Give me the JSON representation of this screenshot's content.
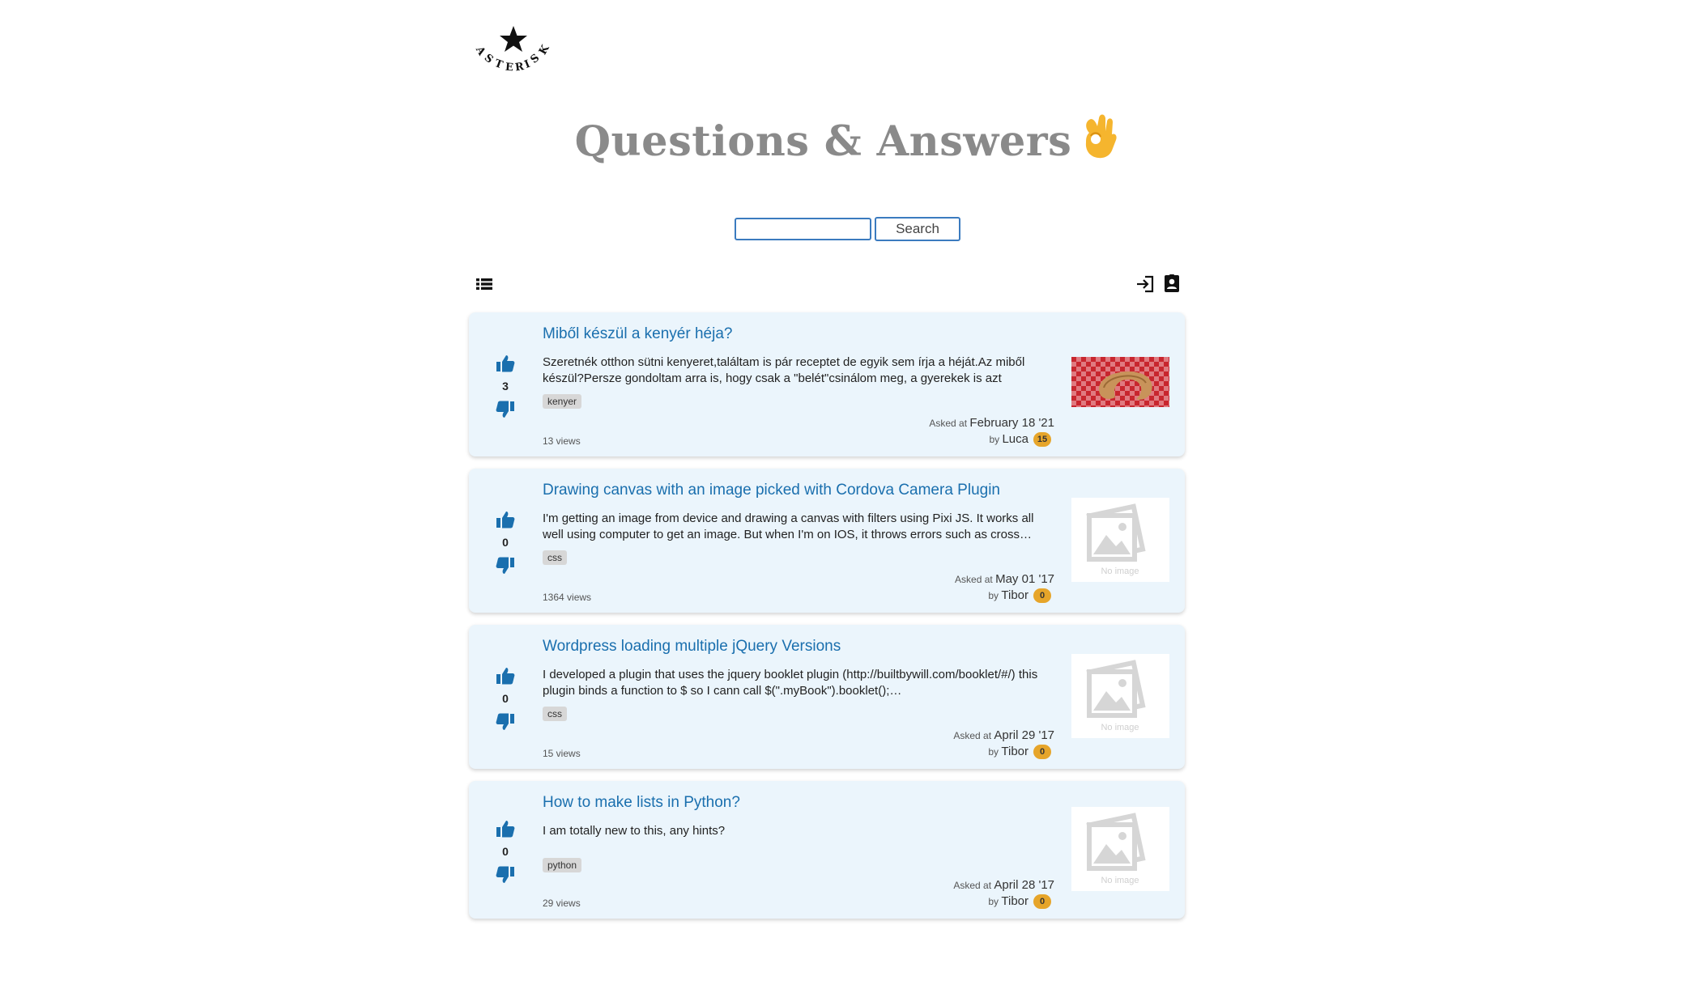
{
  "logo": {
    "text": "ASTERISK"
  },
  "header": {
    "title": "Questions & Answers",
    "title_icon": "ok-hand-emoji"
  },
  "search": {
    "placeholder": "",
    "button_label": "Search"
  },
  "toolbar": {
    "list_icon": "list-icon",
    "login_icon": "login-icon",
    "profile_icon": "profile-icon"
  },
  "questions": [
    {
      "title": "Miből készül a kenyér héja?",
      "excerpt": "Szeretnék otthon sütni kenyeret,találtam is pár receptet de egyik sem írja a héját.Az miből készül?Persze gondoltam arra is, hogy csak a \"belét\"csinálom meg, a gyerekek is azt szereti…",
      "tag": "kenyer",
      "votes": "3",
      "views": "13 views",
      "asked_label": "Asked at",
      "asked_date": "February 18 '21",
      "by_label": "by",
      "author": "Luca",
      "reputation": "15",
      "image": "bread-photo"
    },
    {
      "title": "Drawing canvas with an image picked with Cordova Camera Plugin",
      "excerpt": "I'm getting an image from device and drawing a canvas with filters using Pixi JS. It works all well using computer to get an image. But when I'm on IOS, it throws errors such as cross…",
      "tag": "css",
      "votes": "0",
      "views": "1364 views",
      "asked_label": "Asked at",
      "asked_date": "May 01 '17",
      "by_label": "by",
      "author": "Tibor",
      "reputation": "0",
      "image": "no-image",
      "no_image_label": "No image"
    },
    {
      "title": "Wordpress loading multiple jQuery Versions",
      "excerpt": "I developed a plugin that uses the jquery booklet plugin (http://builtbywill.com/booklet/#/) this plugin binds a function to $ so I cann call $(\".myBook\").booklet();…",
      "tag": "css",
      "votes": "0",
      "views": "15 views",
      "asked_label": "Asked at",
      "asked_date": "April 29 '17",
      "by_label": "by",
      "author": "Tibor",
      "reputation": "0",
      "image": "no-image",
      "no_image_label": "No image"
    },
    {
      "title": "How to make lists in Python?",
      "excerpt": "I am totally new to this, any hints?",
      "tag": "python",
      "votes": "0",
      "views": "29 views",
      "asked_label": "Asked at",
      "asked_date": "April 28 '17",
      "by_label": "by",
      "author": "Tibor",
      "reputation": "0",
      "image": "no-image",
      "no_image_label": "No image"
    }
  ],
  "colors": {
    "link": "#1a6fae",
    "card_bg": "#ebf5fc",
    "badge": "#e6a52a",
    "accent": "#3b7bbf"
  }
}
